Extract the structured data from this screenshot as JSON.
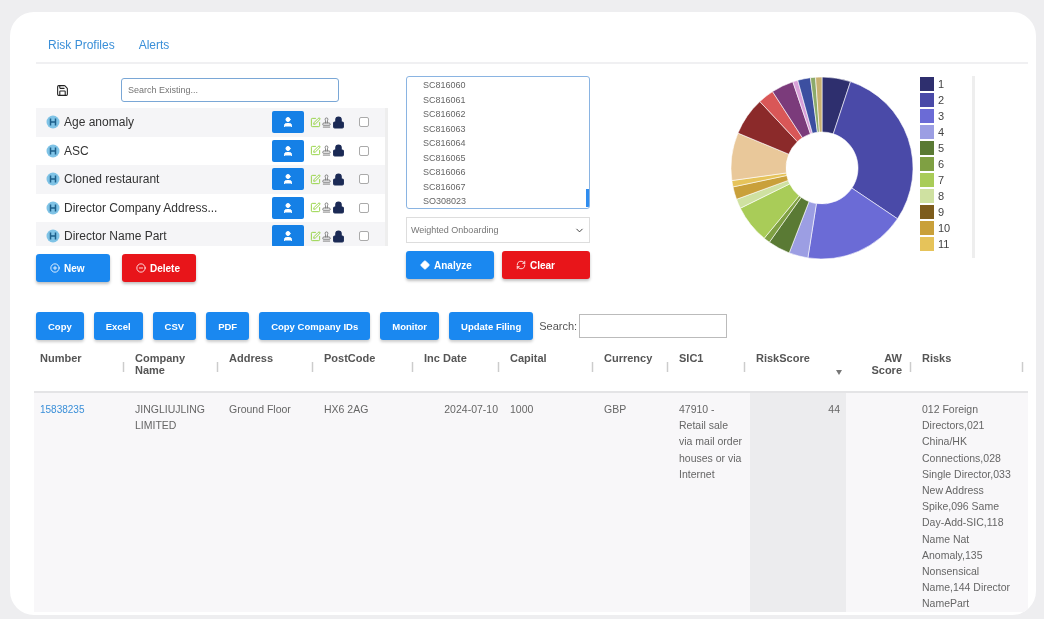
{
  "tabs": [
    {
      "label": "Risk Profiles"
    },
    {
      "label": "Alerts"
    }
  ],
  "profiles": {
    "search": {
      "placeholder": "Search Existing..."
    },
    "items": [
      {
        "name": "Age anomaly",
        "checked": false
      },
      {
        "name": "ASC",
        "checked": false
      },
      {
        "name": "Cloned restaurant",
        "checked": false
      },
      {
        "name": "Director Company Address...",
        "checked": false
      },
      {
        "name": "Director Name Part",
        "checked": false
      }
    ],
    "buttons": [
      {
        "label": "New",
        "kind": "new"
      },
      {
        "label": "Delete",
        "kind": "delete"
      }
    ]
  },
  "analysis": {
    "codes": [
      "SC816060",
      "SC816061",
      "SC816062",
      "SC816063",
      "SC816064",
      "SC816065",
      "SC816066",
      "SC816067",
      "SO308023"
    ],
    "model": "Weighted Onboarding",
    "buttons": [
      {
        "label": "Analyze",
        "kind": "analyze"
      },
      {
        "label": "Clear",
        "kind": "clear"
      }
    ]
  },
  "legend": [
    {
      "label": "1",
      "color": "#2e2f6e"
    },
    {
      "label": "2",
      "color": "#4a4aa8"
    },
    {
      "label": "3",
      "color": "#6b6bd6"
    },
    {
      "label": "4",
      "color": "#9c9ee3"
    },
    {
      "label": "5",
      "color": "#5a7a34"
    },
    {
      "label": "6",
      "color": "#7fa043"
    },
    {
      "label": "7",
      "color": "#a9cc58"
    },
    {
      "label": "8",
      "color": "#cfe1a1"
    },
    {
      "label": "9",
      "color": "#7d5c1c"
    },
    {
      "label": "10",
      "color": "#c9a03a"
    },
    {
      "label": "11",
      "color": "#e6c35a"
    }
  ],
  "toolbar": {
    "buttons": [
      "Copy",
      "Excel",
      "CSV",
      "PDF",
      "Copy Company IDs",
      "Monitor",
      "Update Filing"
    ],
    "search_label": "Search:"
  },
  "table": {
    "columns": [
      {
        "label": "Number",
        "sorted": false
      },
      {
        "label": "Company Name",
        "sorted": false
      },
      {
        "label": "Address",
        "sorted": false
      },
      {
        "label": "PostCode",
        "sorted": false
      },
      {
        "label": "Inc Date",
        "sorted": false
      },
      {
        "label": "Capital",
        "sorted": false
      },
      {
        "label": "Currency",
        "sorted": false
      },
      {
        "label": "SIC1",
        "sorted": false
      },
      {
        "label": "RiskScore",
        "sorted": true
      },
      {
        "label": "AW Score",
        "sorted": false
      },
      {
        "label": "Risks",
        "sorted": false
      }
    ],
    "rows": [
      [
        "15838235",
        "JINGLIUJLING LIMITED",
        "Ground Floor",
        "HX6 2AG",
        "2024-07-10",
        "1000",
        "GBP",
        "47910 - Retail sale via mail order houses or via Internet",
        "44",
        "",
        "012 Foreign Directors,021 China/HK Connections,028 Single Director,033 New Address Spike,096 Same Day-Add-SIC,118 Name Nat Anomaly,135 Nonsensical Name,144 Director NamePart"
      ]
    ]
  }
}
